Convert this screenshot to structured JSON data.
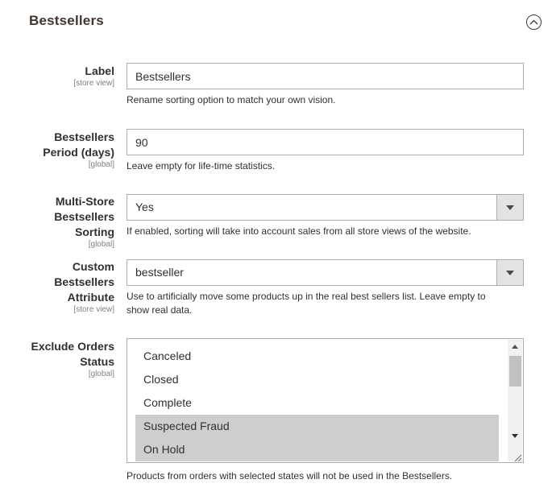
{
  "section": {
    "title": "Bestsellers"
  },
  "fields": {
    "label": {
      "label": "Label",
      "scope": "[store view]",
      "value": "Bestsellers",
      "note": "Rename sorting option to match your own vision."
    },
    "period": {
      "label_line1": "Bestsellers",
      "label_line2": "Period (days)",
      "scope": "[global]",
      "value": "90",
      "note": "Leave empty for life-time statistics."
    },
    "multistore": {
      "label_line1": "Multi-Store",
      "label_line2": "Bestsellers",
      "label_line3": "Sorting",
      "scope": "[global]",
      "value": "Yes",
      "note": "If enabled, sorting will take into account sales from all store views of the website."
    },
    "custom_attribute": {
      "label_line1": "Custom",
      "label_line2": "Bestsellers",
      "label_line3": "Attribute",
      "scope": "[store view]",
      "value": "bestseller",
      "note_line1": "Use to artificially move some products up in the real best sellers list. Leave empty to",
      "note_line2": "show real data."
    },
    "exclude_status": {
      "label_line1": "Exclude Orders",
      "label_line2": "Status",
      "scope": "[global]",
      "options": [
        {
          "label": "Canceled",
          "selected": false
        },
        {
          "label": "Closed",
          "selected": false
        },
        {
          "label": "Complete",
          "selected": false
        },
        {
          "label": "Suspected Fraud",
          "selected": true
        },
        {
          "label": "On Hold",
          "selected": true
        }
      ],
      "note": "Products from orders with selected states will not be used in the Bestsellers."
    }
  },
  "colors": {
    "selected_option_bg": "#cecece",
    "border": "#adadad",
    "title": "#41362f"
  },
  "icons": {
    "collapse": "chevron-up-circle-icon",
    "select_arrow": "triangle-down-icon"
  }
}
